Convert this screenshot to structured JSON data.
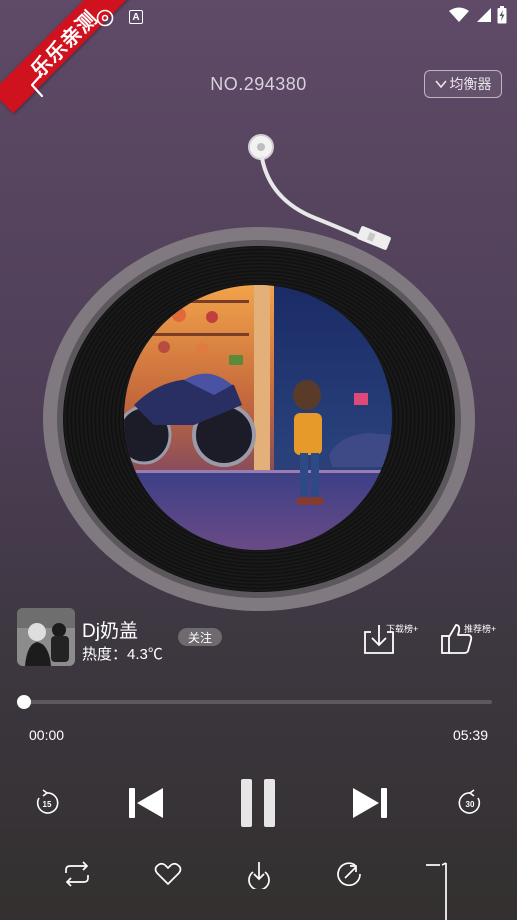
{
  "status_bar": {
    "watermark": "乐乐亲测",
    "icons": [
      "disc-icon",
      "a-badge-icon",
      "wifi-icon",
      "signal-icon",
      "battery-charging-icon"
    ],
    "a_badge": "A"
  },
  "header": {
    "title": "NO.294380",
    "equalizer_label": "均衡器"
  },
  "track": {
    "artist": "Dj奶盖",
    "heat_label": "热度：",
    "heat_value": "4.3℃",
    "follow_label": "关注",
    "download_rank_label": "下载榜+",
    "recommend_rank_label": "推荐榜+"
  },
  "progress": {
    "current": "00:00",
    "total": "05:39",
    "fraction": 0.0
  },
  "controls": {
    "rewind_seconds": "15",
    "forward_seconds": "30"
  },
  "colors": {
    "accent": "#ffffff",
    "ribbon": "#d0121e",
    "bg_top": "#5f4a67",
    "bg_bottom": "#33302f"
  }
}
